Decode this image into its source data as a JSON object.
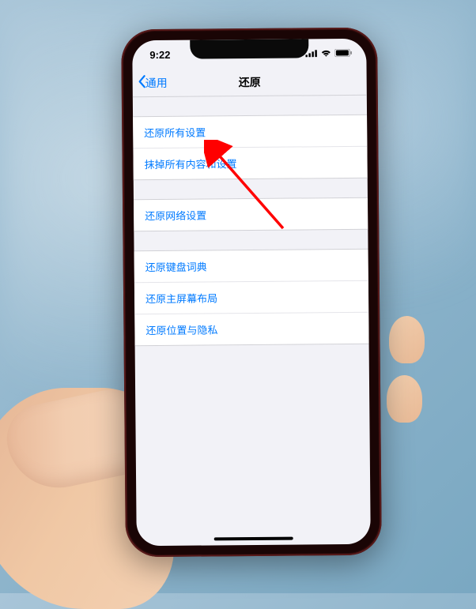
{
  "status": {
    "time": "9:22"
  },
  "nav": {
    "back_label": "通用",
    "title": "还原"
  },
  "groups": [
    {
      "items": [
        {
          "label": "还原所有设置"
        },
        {
          "label": "抹掉所有内容和设置"
        }
      ]
    },
    {
      "items": [
        {
          "label": "还原网络设置"
        }
      ]
    },
    {
      "items": [
        {
          "label": "还原键盘词典"
        },
        {
          "label": "还原主屏幕布局"
        },
        {
          "label": "还原位置与隐私"
        }
      ]
    }
  ]
}
